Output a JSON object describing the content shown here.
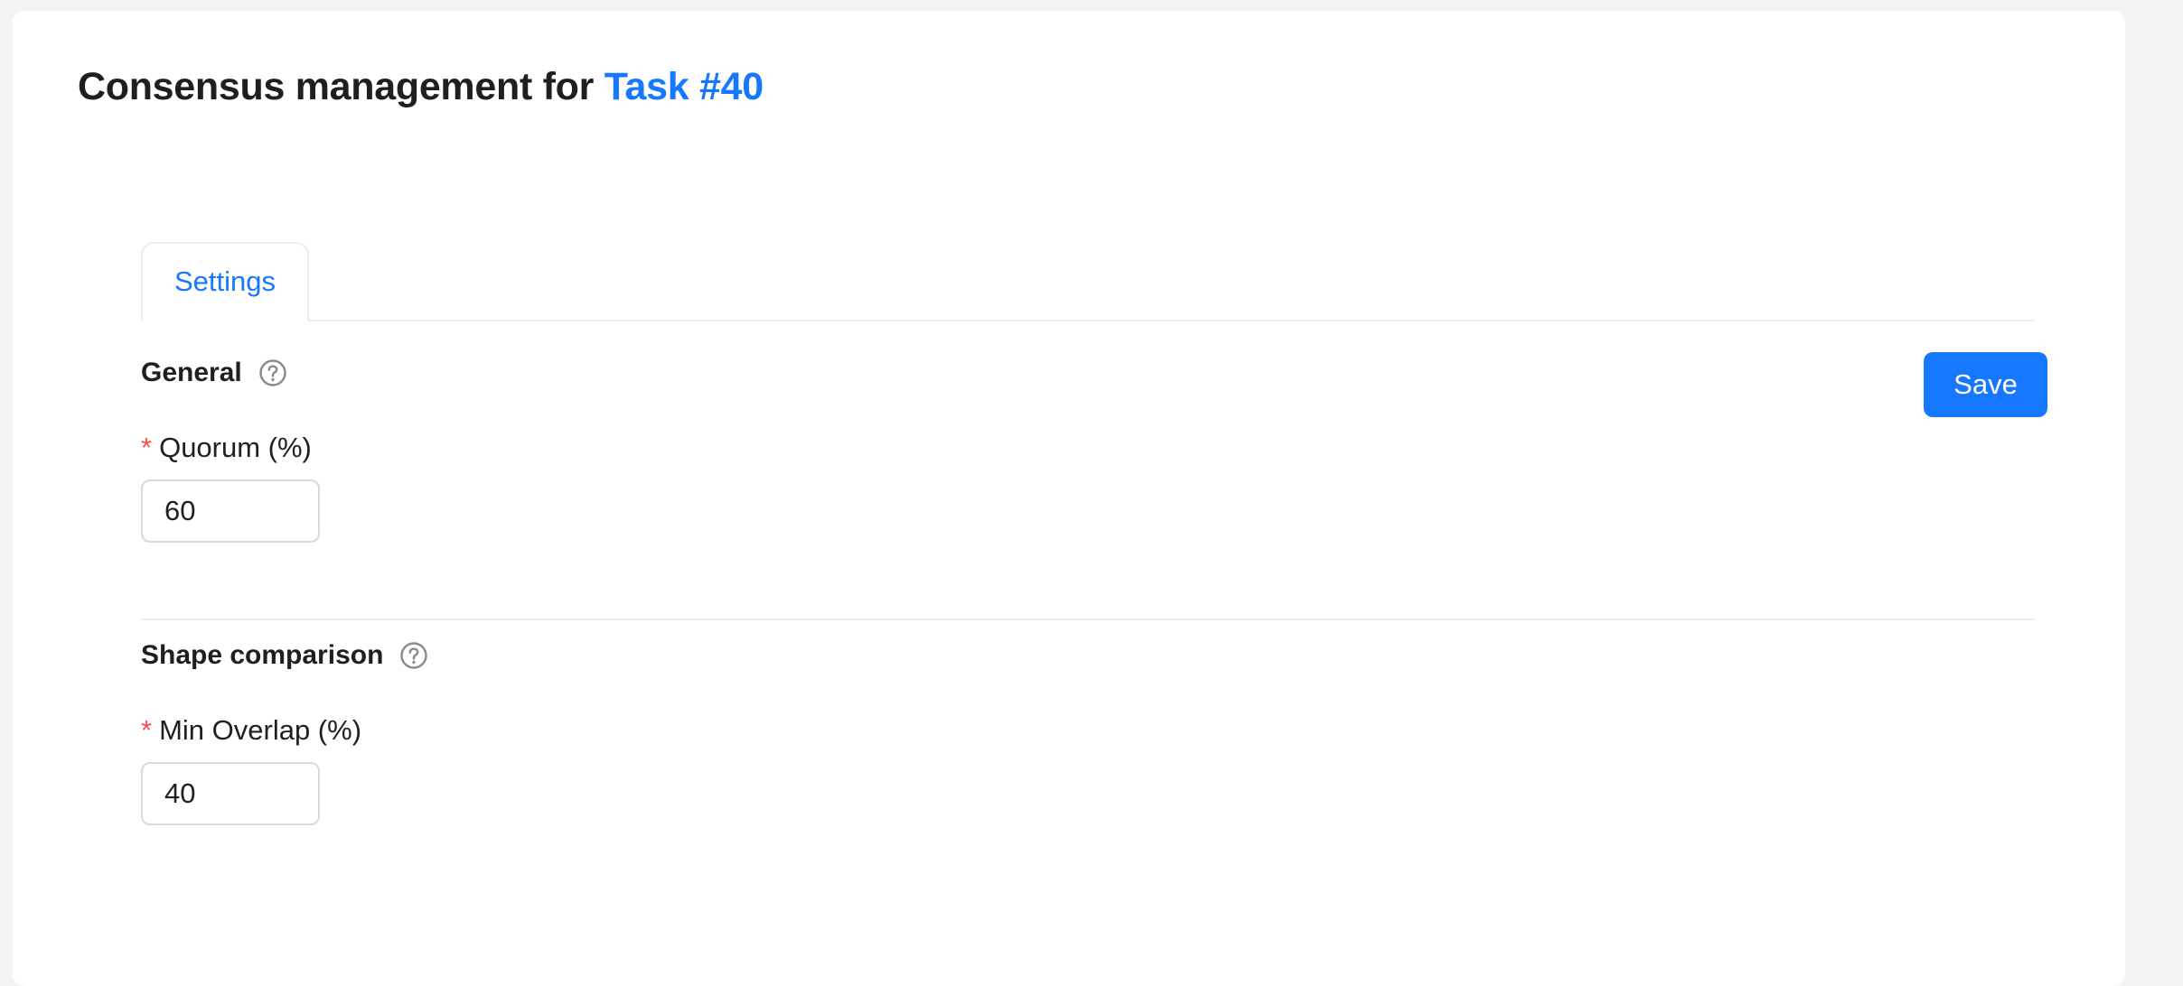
{
  "header": {
    "title_prefix": "Consensus management for",
    "task_link": "Task #40"
  },
  "tabs": [
    {
      "label": "Settings",
      "active": true
    }
  ],
  "actions": {
    "save_label": "Save"
  },
  "sections": {
    "general": {
      "title": "General",
      "help_icon": "question-circle-icon",
      "field": {
        "label": "Quorum (%)",
        "required": true,
        "value": "60"
      }
    },
    "shape_comparison": {
      "title": "Shape comparison",
      "help_icon": "question-circle-icon",
      "field": {
        "label": "Min Overlap (%)",
        "required": true,
        "value": "40"
      }
    }
  },
  "colors": {
    "accent": "#1677ff",
    "required": "#ff4d4f",
    "border": "#d9d9d9",
    "divider": "#ececec",
    "text": "#1f1f1f",
    "background": "#f4f4f4"
  }
}
